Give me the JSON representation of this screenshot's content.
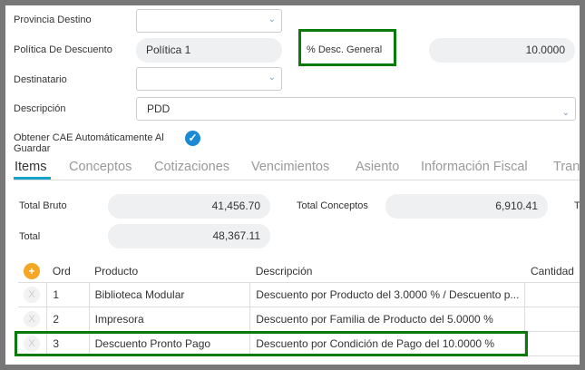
{
  "form": {
    "provincia_label": "Provincia Destino",
    "politica_label": "Política De Descuento",
    "politica_value": "Política 1",
    "desc_general_label": "% Desc. General",
    "desc_general_value": "10.0000",
    "destinatario_label": "Destinatario",
    "descripcion_label": "Descripción",
    "descripcion_value": "PDD",
    "cae_label_1": "Obtener CAE Automáticamente Al",
    "cae_label_2": "Guardar",
    "cae_checked": true
  },
  "tabs": [
    "Items",
    "Conceptos",
    "Cotizaciones",
    "Vencimientos",
    "Asiento",
    "Información Fiscal",
    "Trans"
  ],
  "totals": {
    "bruto_label": "Total Bruto",
    "bruto_value": "41,456.70",
    "conceptos_label": "Total Conceptos",
    "conceptos_value": "6,910.41",
    "total_label": "Total",
    "total_value": "48,367.11",
    "clipped_label": "T"
  },
  "table": {
    "headers": {
      "add": "+",
      "ord": "Ord",
      "producto": "Producto",
      "descripcion": "Descripción",
      "cantidad": "Cantidad"
    },
    "rows": [
      {
        "remove": "X",
        "ord": "1",
        "producto": "Biblioteca Modular",
        "descripcion": "Descuento por Producto del 3.0000 % / Descuento p..."
      },
      {
        "remove": "X",
        "ord": "2",
        "producto": "Impresora",
        "descripcion": "Descuento por Familia de Producto del 5.0000 %"
      },
      {
        "remove": "X",
        "ord": "3",
        "producto": "Descuento Pronto Pago",
        "descripcion": "Descuento por Condición de Pago del 10.0000 %"
      }
    ]
  },
  "colors": {
    "highlight": "#0a7a0a",
    "tab_active": "#1aa3c8",
    "check": "#1a8ad4",
    "add": "#f5a623"
  }
}
